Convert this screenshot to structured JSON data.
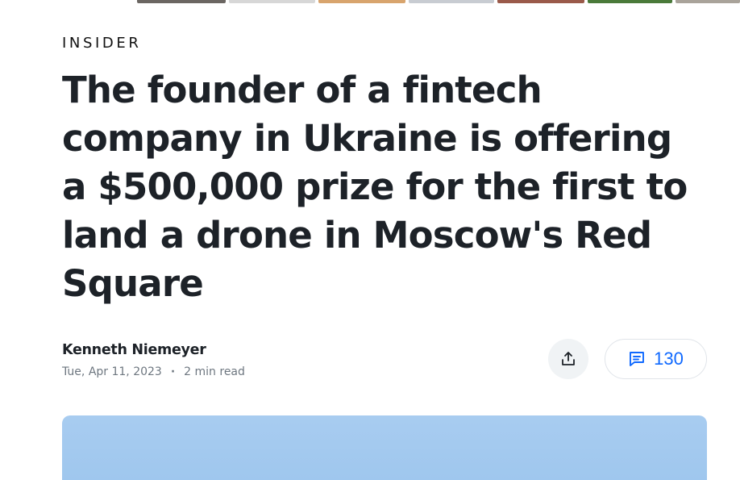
{
  "thumbnails": 7,
  "brand": "INSIDER",
  "headline": "The founder of a fintech company in Ukraine is offering a $500,000 prize for the first to land a drone in Moscow's Red Square",
  "author": "Kenneth Niemeyer",
  "date": "Tue, Apr 11, 2023",
  "separator": "·",
  "read_time": "2 min read",
  "comments": {
    "count": "130",
    "color": "#0f69ff"
  },
  "icons": {
    "share": "share-icon",
    "comment": "comment-icon"
  }
}
